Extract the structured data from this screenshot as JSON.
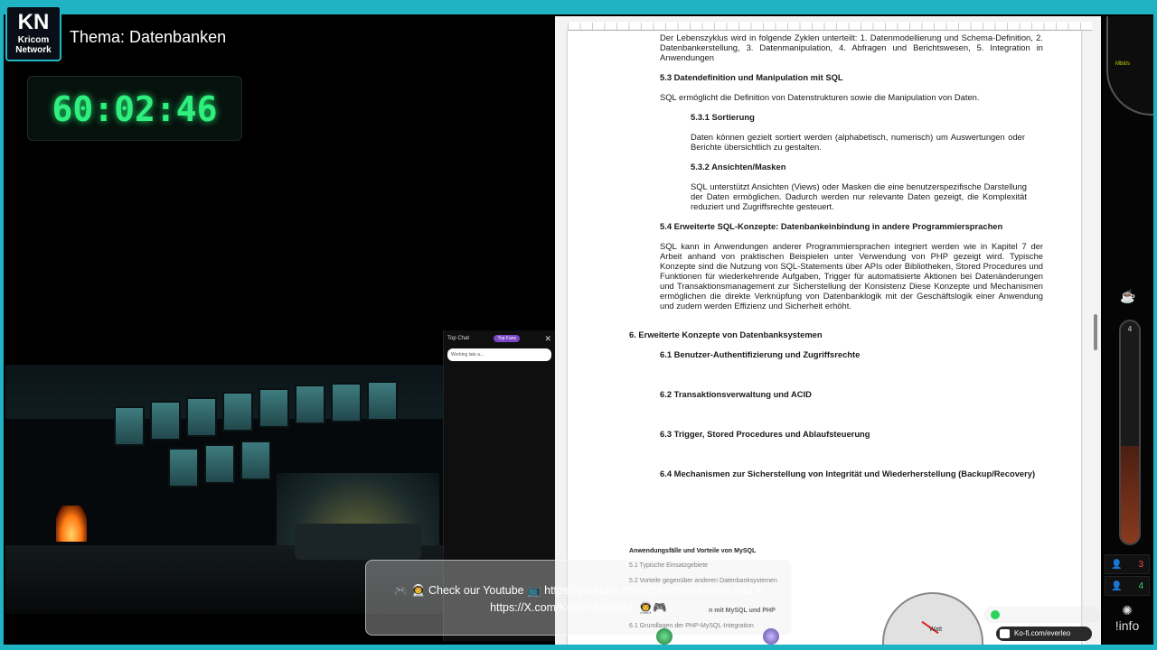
{
  "stream": {
    "logo_main": "KN",
    "logo_sub1": "Kricom",
    "logo_sub2": "Network",
    "topic": "Thema: Datenbanken",
    "timer": "60:02:46"
  },
  "chat": {
    "header": "Top Chat",
    "top_fans": "Top Fans",
    "pinned": "Working late a..."
  },
  "document": {
    "intro": "Der Lebenszyklus wird in folgende Zyklen unterteilt: 1. Datenmodellierung und Schema-Definition, 2. Datenbankerstellung, 3. Datenmanipulation, 4. Abfragen und Berichtswesen, 5. Integration in Anwendungen",
    "h53": "5.3 Datendefinition und Manipulation mit SQL",
    "p53": "SQL ermöglicht die Definition von Datenstrukturen sowie die Manipulation von Daten.",
    "h531": "5.3.1 Sortierung",
    "p531": "Daten können gezielt sortiert werden (alphabetisch, numerisch) um Auswertungen oder Berichte übersichtlich zu gestalten.",
    "h532": "5.3.2 Ansichten/Masken",
    "p532": "SQL unterstützt Ansichten (Views) oder Masken die eine benutzerspezifische Darstellung der Daten ermöglichen. Dadurch werden nur relevante Daten gezeigt, die Komplexität reduziert und Zugriffsrechte gesteuert.",
    "h54": "5.4 Erweiterte SQL-Konzepte: Datenbankeinbindung in andere Programmiersprachen",
    "p54": "SQL kann in Anwendungen anderer Programmiersprachen integriert werden wie in Kapitel 7 der Arbeit anhand von praktischen Beispielen unter Verwendung von PHP gezeigt wird. Typische Konzepte sind die Nutzung von SQL-Statements über APIs oder Bibliotheken, Stored Procedures und Funktionen für wiederkehrende Aufgaben, Trigger für automatisierte Aktionen bei Datenänderungen und Transaktionsmanagement zur Sicherstellung der Konsistenz Diese Konzepte und Mechanismen ermöglichen die direkte Verknüpfung von Datenbanklogik mit der Geschäftslogik einer Anwendung und zudem werden Effizienz und Sicherheit erhöht.",
    "h6": "6. Erweiterte Konzepte von Datenbanksystemen",
    "h61": "6.1 Benutzer-Authentifizierung und Zugriffsrechte",
    "h62": "6.2 Transaktionsverwaltung und ACID",
    "h63": "6.3 Trigger, Stored Procedures und Ablaufsteuerung",
    "h64": "6.4 Mechanismen zur Sicherstellung von Integrität und Wiederherstellung (Backup/Recovery)",
    "outline_title": "Anwendungsfälle und Vorteile von MySQL",
    "o51": "5.1 Typische Einsatzgebiete",
    "o52": "5.2 Vorteile gegenüber anderen Datenbanksystemen",
    "o_mid": "n mit MySQL und PHP",
    "o61": "6.1 Grundlagen der PHP-MySQL-Integration"
  },
  "banner": {
    "line1": "🎮 👨‍🚀 Check our Youtube 📺 https://youtube.com/@kricomnetwork and X",
    "line2": "https://X.com/KricomNetwork 👨‍🚀🎮"
  },
  "sidebar": {
    "speed_label": "Mbit/s",
    "tube_value": "4",
    "viewers_red": "3",
    "viewers_green": "4",
    "info": "!info"
  },
  "gauge": {
    "label": "Watt"
  },
  "kofi": {
    "label": "Ko-fi.com/everleo"
  },
  "colors": {
    "accent": "#1fb3c4",
    "timer": "#2ff07e",
    "kofi": "#ff5e5b"
  }
}
